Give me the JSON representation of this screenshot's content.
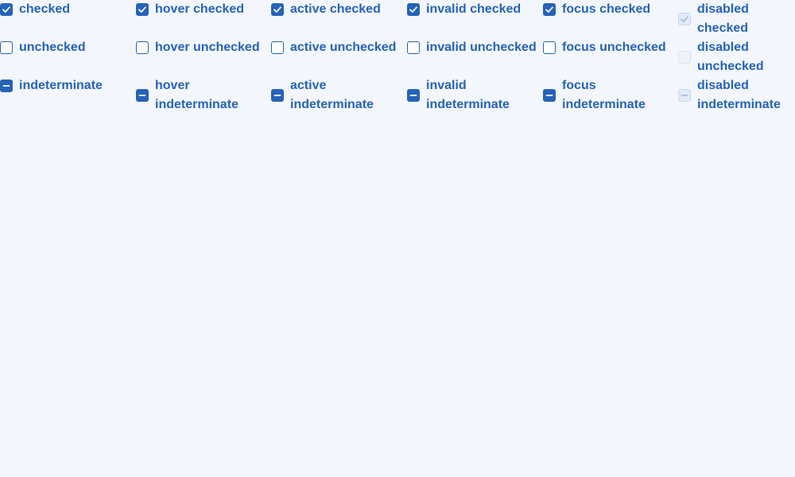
{
  "colors": {
    "accent": "#2563b8",
    "background": "#f3f7fd",
    "disabled_border": "#d6e1f2",
    "disabled_fill": "#e3ebf8",
    "disabled_mark": "#a9c0e3"
  },
  "rows": [
    {
      "cells": [
        {
          "label": "checked",
          "state": "checked",
          "icon": "checkmark-icon",
          "disabled": false
        },
        {
          "label": "hover checked",
          "state": "checked",
          "icon": "checkmark-icon",
          "disabled": false
        },
        {
          "label": "active checked",
          "state": "checked",
          "icon": "checkmark-icon",
          "disabled": false
        },
        {
          "label": "invalid checked",
          "state": "checked",
          "icon": "checkmark-icon",
          "disabled": false
        },
        {
          "label": "focus checked",
          "state": "checked",
          "icon": "checkmark-icon",
          "disabled": false
        },
        {
          "label": "disabled checked",
          "state": "checked",
          "icon": "checkmark-icon",
          "disabled": true
        }
      ]
    },
    {
      "cells": [
        {
          "label": "unchecked",
          "state": "unchecked",
          "icon": "empty-box-icon",
          "disabled": false
        },
        {
          "label": "hover unchecked",
          "state": "unchecked",
          "icon": "empty-box-icon",
          "disabled": false
        },
        {
          "label": "active unchecked",
          "state": "unchecked",
          "icon": "empty-box-icon",
          "disabled": false
        },
        {
          "label": "invalid unchecked",
          "state": "unchecked",
          "icon": "empty-box-icon",
          "disabled": false
        },
        {
          "label": "focus unchecked",
          "state": "unchecked",
          "icon": "empty-box-icon",
          "disabled": false
        },
        {
          "label": "disabled unchecked",
          "state": "unchecked",
          "icon": "empty-box-icon",
          "disabled": true
        }
      ]
    },
    {
      "cells": [
        {
          "label": "indeterminate",
          "state": "indeterminate",
          "icon": "minus-icon",
          "disabled": false
        },
        {
          "label": "hover indeterminate",
          "state": "indeterminate",
          "icon": "minus-icon",
          "disabled": false
        },
        {
          "label": "active indeterminate",
          "state": "indeterminate",
          "icon": "minus-icon",
          "disabled": false
        },
        {
          "label": "invalid indeterminate",
          "state": "indeterminate",
          "icon": "minus-icon",
          "disabled": false
        },
        {
          "label": "focus indeterminate",
          "state": "indeterminate",
          "icon": "minus-icon",
          "disabled": false
        },
        {
          "label": "disabled indeterminate",
          "state": "indeterminate",
          "icon": "minus-icon",
          "disabled": true
        }
      ]
    }
  ]
}
